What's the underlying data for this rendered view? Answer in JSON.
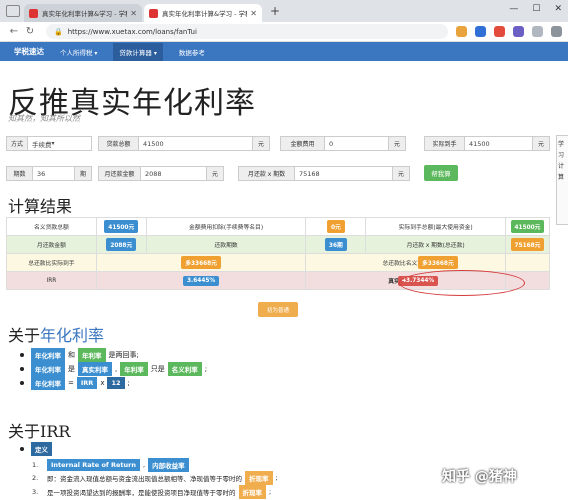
{
  "browser": {
    "tabs": [
      {
        "title": "真实年化利率计算&学习 - 学税..."
      },
      {
        "title": "真实年化利率计算&学习 - 学税..."
      }
    ],
    "url": "https://www.xuetax.com/loans/fanTui"
  },
  "nav": {
    "brand": "学税速达",
    "items": [
      "个人所得税",
      "贷款计算器",
      "数据参考"
    ]
  },
  "page": {
    "title": "反推真实年化利率",
    "subtitle": "知其然，知其所以然"
  },
  "form": {
    "method_label": "方式",
    "method_value": "手续费",
    "principal_label": "贷款总额",
    "principal_value": "41500",
    "principal_unit": "元",
    "fee_label": "金额费用",
    "fee_value": "0",
    "fee_unit": "元",
    "actual_label": "实际到手",
    "actual_value": "41500",
    "actual_unit": "元",
    "periods_label": "期数",
    "periods_value": "36",
    "periods_unit": "期",
    "monthly_label": "月还款金额",
    "monthly_value": "2088",
    "monthly_unit": "元",
    "total_label": "月还款 x 期数",
    "total_value": "75168",
    "total_unit": "元",
    "calc_button": "帮我算"
  },
  "side_panel": {
    "lines": [
      "学",
      "习",
      "计",
      "算"
    ]
  },
  "results": {
    "heading": "计算结果",
    "rows": [
      [
        "名义贷款总额",
        "41500元",
        "金额费用扣除(手续费等名目)",
        "0元",
        "实际到手总额(最大使用资金)",
        "41500元"
      ],
      [
        "月还款金额",
        "2088元",
        "还款期数",
        "36期",
        "月还款 x 期数(总还款)",
        "75168元"
      ],
      [
        "总还款比实际到手",
        "多33668元",
        "",
        "总还款比名义贷款",
        "多33668元",
        ""
      ],
      [
        "IRR",
        "3.6445%",
        "真实年化利率",
        "43.7344%",
        "",
        ""
      ]
    ],
    "reset_button": "初为普通"
  },
  "about1": {
    "heading_prefix": "关于",
    "heading_hl": "年化利率",
    "lines": [
      {
        "a": "年化利率",
        "b": "和",
        "c": "年利率",
        "d": "是两回事;"
      },
      {
        "a": "年化利率",
        "b": "是",
        "c": "真实利率",
        "c2": "年利率",
        "d": "只是",
        "e": "名义利率",
        "f": ";"
      },
      {
        "a": "年化利率",
        "b": "=",
        "c": "IRR",
        "d": "x",
        "e": "12",
        "f": ";"
      }
    ]
  },
  "about2": {
    "heading": "关于IRR",
    "def_tag": "定义",
    "items": [
      {
        "n": "1.",
        "a": "Internal Rate of Return",
        "sep": ",",
        "b": "内部收益率"
      },
      {
        "n": "2.",
        "text": "即：资金流入现值总额与资金流出现值总额相等、净现值等于零时的",
        "tag": "折现率",
        "end": ";"
      },
      {
        "n": "3.",
        "text": "是一项投资渴望达到的报酬率，是能使投资项目净现值等于零时的",
        "tag": "折现率",
        "end": ";"
      }
    ]
  },
  "watermark": "知乎 @猪神",
  "colors": {
    "nav": "#3b76c0",
    "chip_blue": "#3b8fd1",
    "chip_orange": "#f0a030",
    "chip_green": "#5cb85c",
    "chip_red": "#d9534f"
  }
}
